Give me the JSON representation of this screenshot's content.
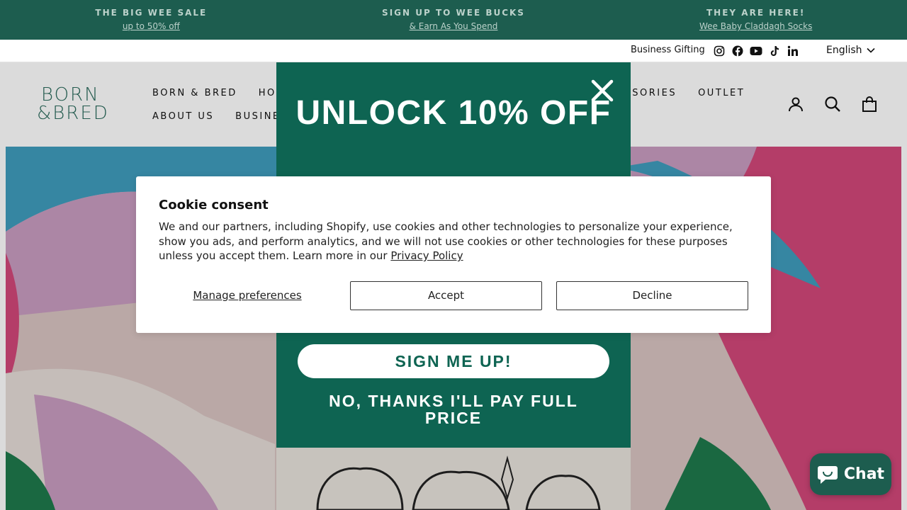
{
  "announcements": [
    {
      "title": "THE BIG WEE SALE",
      "link": "up to 50% off"
    },
    {
      "title": "SIGN UP TO WEE BUCKS",
      "link": "& Earn As You Spend"
    },
    {
      "title": "THEY ARE HERE!",
      "link": "Wee Baby Claddagh Socks"
    }
  ],
  "utility": {
    "gifting": "Business Gifting",
    "socials": [
      "instagram-icon",
      "facebook-icon",
      "youtube-icon",
      "tiktok-icon",
      "linkedin-icon"
    ],
    "language": "English"
  },
  "header": {
    "logo_line1": "BORN",
    "logo_line2": "&BRED",
    "nav_row1": [
      "BORN & BRED",
      "HOM",
      "SSORIES",
      "OUTLET"
    ],
    "nav_row2": [
      "ABOUT US",
      "BUSINES"
    ],
    "icons": [
      "account-icon",
      "search-icon",
      "cart-icon"
    ]
  },
  "popup": {
    "title": "UNLOCK 10% OFF",
    "signup": "SIGN ME UP!",
    "decline": "NO, THANKS I'LL PAY FULL PRICE"
  },
  "cookie": {
    "title": "Cookie consent",
    "text": "We and our partners, including Shopify, use cookies and other technologies to personalize your experience, show you ads, and perform analytics, and we will not use cookies or other technologies for these purposes unless you accept them. Learn more in our ",
    "link": "Privacy Policy",
    "manage": "Manage preferences",
    "accept": "Accept",
    "decline": "Decline"
  },
  "chat": {
    "label": "Chat"
  },
  "colors": {
    "brand_green": "#1d5d4f",
    "popup_green": "#0e6452"
  }
}
